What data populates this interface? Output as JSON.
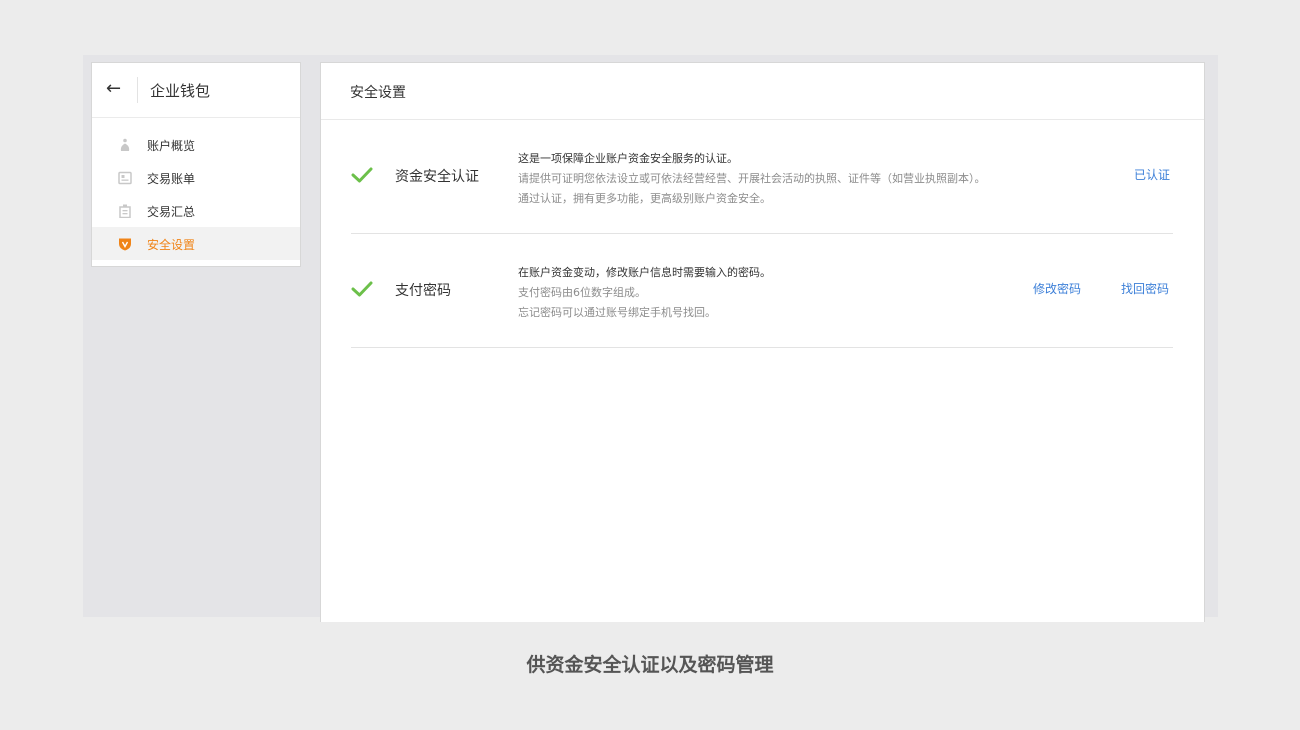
{
  "sidebar": {
    "title": "企业钱包",
    "items": [
      {
        "label": "账户概览",
        "icon": "money-bag-icon"
      },
      {
        "label": "交易账单",
        "icon": "bill-icon"
      },
      {
        "label": "交易汇总",
        "icon": "summary-icon"
      },
      {
        "label": "安全设置",
        "icon": "shield-icon",
        "active": true
      }
    ]
  },
  "main": {
    "title": "安全设置",
    "rows": [
      {
        "name": "资金安全认证",
        "desc_main": "这是一项保障企业账户资金安全服务的认证。",
        "desc_sub1": "请提供可证明您依法设立或可依法经营经营、开展社会活动的执照、证件等（如营业执照副本）。",
        "desc_sub2": "通过认证，拥有更多功能，更高级别账户资金安全。",
        "action": "已认证"
      },
      {
        "name": "支付密码",
        "desc_main": "在账户资金变动，修改账户信息时需要输入的密码。",
        "desc_sub1": "支付密码由6位数字组成。",
        "desc_sub2": "忘记密码可以通过账号绑定手机号找回。",
        "action_modify": "修改密码",
        "action_recover": "找回密码"
      }
    ]
  },
  "caption": "供资金安全认证以及密码管理",
  "colors": {
    "accent": "#f08418",
    "link": "#3c7fd8",
    "check": "#6cc04a"
  }
}
